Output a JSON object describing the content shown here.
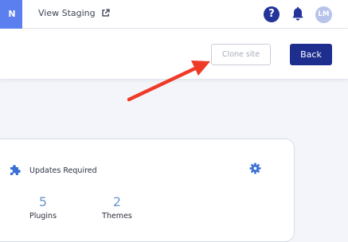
{
  "topbar": {
    "tab_label": "N",
    "staging_label": "View Staging",
    "help_label": "?",
    "avatar_initials": "LM"
  },
  "actions": {
    "clone_label": "Clone site",
    "back_label": "Back"
  },
  "updates_card": {
    "title": "Updates Required",
    "stats": [
      {
        "value": "5",
        "label": "Plugins"
      },
      {
        "value": "2",
        "label": "Themes"
      }
    ]
  },
  "colors": {
    "brand_navy": "#1e2e8f",
    "tab_blue": "#5b7fee",
    "annotation_red": "#ee3a27",
    "stat_blue": "#6f95cf"
  },
  "icons": [
    "external-link-icon",
    "help-icon",
    "bell-icon",
    "puzzle-icon",
    "gear-icon"
  ]
}
